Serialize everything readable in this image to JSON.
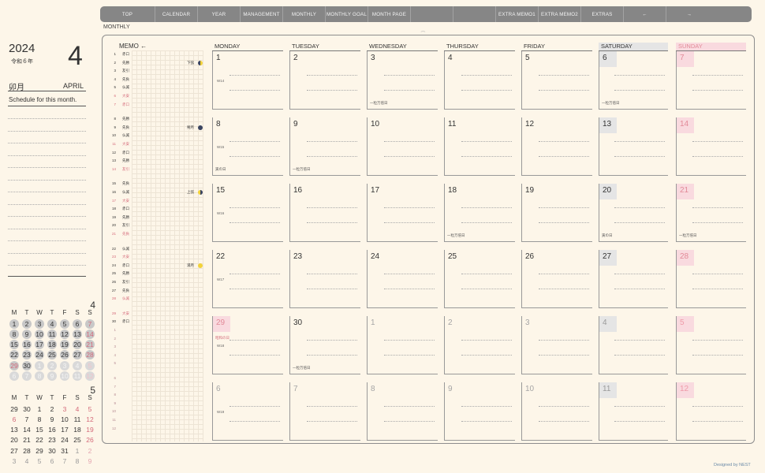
{
  "nav": {
    "items": [
      {
        "label": "TOP",
        "w": 70
      },
      {
        "label": "CALENDAR",
        "w": 54
      },
      {
        "label": "YEAR",
        "w": 54
      },
      {
        "label": "MANAGEMENT",
        "w": 54
      },
      {
        "label": "MONTHLY",
        "w": 54
      },
      {
        "label": "MONTHLY GOAL",
        "w": 54
      },
      {
        "label": "MONTH PAGE",
        "w": 54
      },
      {
        "label": "",
        "w": 54
      },
      {
        "label": "",
        "w": 54
      },
      {
        "label": "EXTRA MEMO1",
        "w": 54
      },
      {
        "label": "EXTRA MEMO2",
        "w": 54
      },
      {
        "label": "EXTRAS",
        "w": 54
      },
      {
        "label": "←",
        "w": 54
      },
      {
        "label": "→",
        "w": 58
      }
    ]
  },
  "section_label": "MONTHLY",
  "sidebar": {
    "year": "2024",
    "wareki": "令和６年",
    "month_number": "4",
    "month_jp": "卯月",
    "month_en": "APRIL",
    "schedule_label": "Schedule for this month."
  },
  "mini_cal_current": {
    "month_number": "4",
    "weekday_headers": [
      "M",
      "T",
      "W",
      "T",
      "F",
      "S",
      "S"
    ],
    "weeks": [
      [
        [
          "1",
          "d"
        ],
        [
          "2",
          "d"
        ],
        [
          "3",
          "d"
        ],
        [
          "4",
          "d"
        ],
        [
          "5",
          "d"
        ],
        [
          "6",
          "d"
        ],
        [
          "7",
          "s"
        ]
      ],
      [
        [
          "8",
          "d"
        ],
        [
          "9",
          "d"
        ],
        [
          "10",
          "d"
        ],
        [
          "11",
          "d"
        ],
        [
          "12",
          "d"
        ],
        [
          "13",
          "d"
        ],
        [
          "14",
          "s"
        ]
      ],
      [
        [
          "15",
          "d"
        ],
        [
          "16",
          "d"
        ],
        [
          "17",
          "d"
        ],
        [
          "18",
          "d"
        ],
        [
          "19",
          "d"
        ],
        [
          "20",
          "d"
        ],
        [
          "21",
          "s"
        ]
      ],
      [
        [
          "22",
          "d"
        ],
        [
          "23",
          "d"
        ],
        [
          "24",
          "d"
        ],
        [
          "25",
          "d"
        ],
        [
          "26",
          "d"
        ],
        [
          "27",
          "d"
        ],
        [
          "28",
          "s"
        ]
      ],
      [
        [
          "29",
          "s"
        ],
        [
          "30",
          "d"
        ],
        [
          "1",
          "o"
        ],
        [
          "2",
          "o"
        ],
        [
          "3",
          "o"
        ],
        [
          "4",
          "o"
        ],
        [
          "5",
          "os"
        ]
      ],
      [
        [
          "6",
          "o"
        ],
        [
          "7",
          "o"
        ],
        [
          "8",
          "o"
        ],
        [
          "9",
          "o"
        ],
        [
          "10",
          "o"
        ],
        [
          "11",
          "o"
        ],
        [
          "12",
          "os"
        ]
      ]
    ]
  },
  "mini_cal_next": {
    "month_number": "5",
    "weekday_headers": [
      "M",
      "T",
      "W",
      "T",
      "F",
      "S",
      "S"
    ],
    "weeks": [
      [
        [
          "29",
          "d"
        ],
        [
          "30",
          "d"
        ],
        [
          "1",
          "d"
        ],
        [
          "2",
          "d"
        ],
        [
          "3",
          "r"
        ],
        [
          "4",
          "r"
        ],
        [
          "5",
          "r"
        ]
      ],
      [
        [
          "6",
          "r"
        ],
        [
          "7",
          "d"
        ],
        [
          "8",
          "d"
        ],
        [
          "9",
          "d"
        ],
        [
          "10",
          "d"
        ],
        [
          "11",
          "d"
        ],
        [
          "12",
          "r"
        ]
      ],
      [
        [
          "13",
          "d"
        ],
        [
          "14",
          "d"
        ],
        [
          "15",
          "d"
        ],
        [
          "16",
          "d"
        ],
        [
          "17",
          "d"
        ],
        [
          "18",
          "d"
        ],
        [
          "19",
          "r"
        ]
      ],
      [
        [
          "20",
          "d"
        ],
        [
          "21",
          "d"
        ],
        [
          "22",
          "d"
        ],
        [
          "23",
          "d"
        ],
        [
          "24",
          "d"
        ],
        [
          "25",
          "d"
        ],
        [
          "26",
          "r"
        ]
      ],
      [
        [
          "27",
          "d"
        ],
        [
          "28",
          "d"
        ],
        [
          "29",
          "d"
        ],
        [
          "30",
          "d"
        ],
        [
          "31",
          "d"
        ],
        [
          "1",
          "g"
        ],
        [
          "2",
          "p"
        ]
      ],
      [
        [
          "3",
          "g"
        ],
        [
          "4",
          "g"
        ],
        [
          "5",
          "g"
        ],
        [
          "6",
          "g"
        ],
        [
          "7",
          "g"
        ],
        [
          "8",
          "g"
        ],
        [
          "9",
          "p"
        ]
      ]
    ]
  },
  "memo": {
    "title": "MEMO ←",
    "rows": [
      {
        "n": "1",
        "r": "赤口"
      },
      {
        "n": "2",
        "r": "先勝",
        "moon": "下弦",
        "icon": "half"
      },
      {
        "n": "3",
        "r": "友引"
      },
      {
        "n": "4",
        "r": "先負"
      },
      {
        "n": "5",
        "r": "仏滅"
      },
      {
        "n": "6",
        "r": "大安",
        "red": true
      },
      {
        "n": "7",
        "r": "赤口",
        "red": true
      },
      {
        "gap": true
      },
      {
        "n": "8",
        "r": "先勝"
      },
      {
        "n": "9",
        "r": "先負",
        "moon": "朔月",
        "icon": "new"
      },
      {
        "n": "10",
        "r": "仏滅"
      },
      {
        "n": "11",
        "r": "大安",
        "red": true
      },
      {
        "n": "12",
        "r": "赤口"
      },
      {
        "n": "13",
        "r": "先勝"
      },
      {
        "n": "14",
        "r": "友引",
        "red": true
      },
      {
        "gap": true
      },
      {
        "n": "15",
        "r": "先負"
      },
      {
        "n": "16",
        "r": "仏滅",
        "moon": "上弦",
        "icon": "half2"
      },
      {
        "n": "17",
        "r": "大安",
        "red": true
      },
      {
        "n": "18",
        "r": "赤口"
      },
      {
        "n": "19",
        "r": "先勝"
      },
      {
        "n": "20",
        "r": "友引"
      },
      {
        "n": "21",
        "r": "先負",
        "red": true
      },
      {
        "gap": true
      },
      {
        "n": "22",
        "r": "仏滅"
      },
      {
        "n": "23",
        "r": "大安",
        "red": true
      },
      {
        "n": "24",
        "r": "赤口",
        "moon": "満月",
        "icon": "full"
      },
      {
        "n": "25",
        "r": "先勝"
      },
      {
        "n": "26",
        "r": "友引"
      },
      {
        "n": "27",
        "r": "先負"
      },
      {
        "n": "28",
        "r": "仏滅",
        "red": true
      },
      {
        "gap": true
      },
      {
        "n": "29",
        "r": "大安",
        "red": true
      },
      {
        "n": "30",
        "r": "赤口"
      },
      {
        "n": "1",
        "pale": true
      },
      {
        "n": "2",
        "pale": true
      },
      {
        "n": "3",
        "pale": true
      },
      {
        "n": "4",
        "pale": true
      },
      {
        "n": "5",
        "pale": true
      },
      {
        "gap": true
      },
      {
        "n": "6",
        "pale": true
      },
      {
        "n": "7",
        "pale": true
      },
      {
        "n": "8",
        "pale": true
      },
      {
        "n": "9",
        "pale": true
      },
      {
        "n": "10",
        "pale": true
      },
      {
        "n": "11",
        "pale": true
      },
      {
        "n": "12",
        "pale": true
      }
    ]
  },
  "day_headers": [
    "MONDAY",
    "TUESDAY",
    "WEDNESDAY",
    "THURSDAY",
    "FRIDAY",
    "SATURDAY",
    "SUNDAY"
  ],
  "weeks": [
    {
      "wk": "W14",
      "days": [
        {
          "d": "1"
        },
        {
          "d": "2"
        },
        {
          "d": "3",
          "note": "一粒万倍日"
        },
        {
          "d": "4"
        },
        {
          "d": "5"
        },
        {
          "d": "6",
          "note": "一粒万倍日"
        },
        {
          "d": "7"
        }
      ]
    },
    {
      "wk": "W15",
      "days": [
        {
          "d": "8",
          "note": "寅の日"
        },
        {
          "d": "9",
          "note": "一粒万倍日"
        },
        {
          "d": "10"
        },
        {
          "d": "11"
        },
        {
          "d": "12"
        },
        {
          "d": "13"
        },
        {
          "d": "14"
        }
      ]
    },
    {
      "wk": "W16",
      "days": [
        {
          "d": "15"
        },
        {
          "d": "16"
        },
        {
          "d": "17"
        },
        {
          "d": "18",
          "note": "一粒万倍日"
        },
        {
          "d": "19"
        },
        {
          "d": "20",
          "note": "寅の日"
        },
        {
          "d": "21",
          "note": "一粒万倍日"
        }
      ]
    },
    {
      "wk": "W17",
      "days": [
        {
          "d": "22"
        },
        {
          "d": "23"
        },
        {
          "d": "24"
        },
        {
          "d": "25"
        },
        {
          "d": "26"
        },
        {
          "d": "27"
        },
        {
          "d": "28"
        }
      ]
    },
    {
      "wk": "W18",
      "days": [
        {
          "d": "29",
          "holiday": "昭和の日"
        },
        {
          "d": "30",
          "note": "一粒万倍日"
        },
        {
          "d": "1",
          "out": true
        },
        {
          "d": "2",
          "out": true
        },
        {
          "d": "3",
          "out": true
        },
        {
          "d": "4",
          "out": true
        },
        {
          "d": "5",
          "out": true
        }
      ]
    },
    {
      "wk": "W19",
      "days": [
        {
          "d": "6",
          "out": true
        },
        {
          "d": "7",
          "out": true
        },
        {
          "d": "8",
          "out": true
        },
        {
          "d": "9",
          "out": true
        },
        {
          "d": "10",
          "out": true
        },
        {
          "d": "11",
          "out": true
        },
        {
          "d": "12",
          "out": true
        }
      ]
    }
  ],
  "footer": "Designed by NEST"
}
